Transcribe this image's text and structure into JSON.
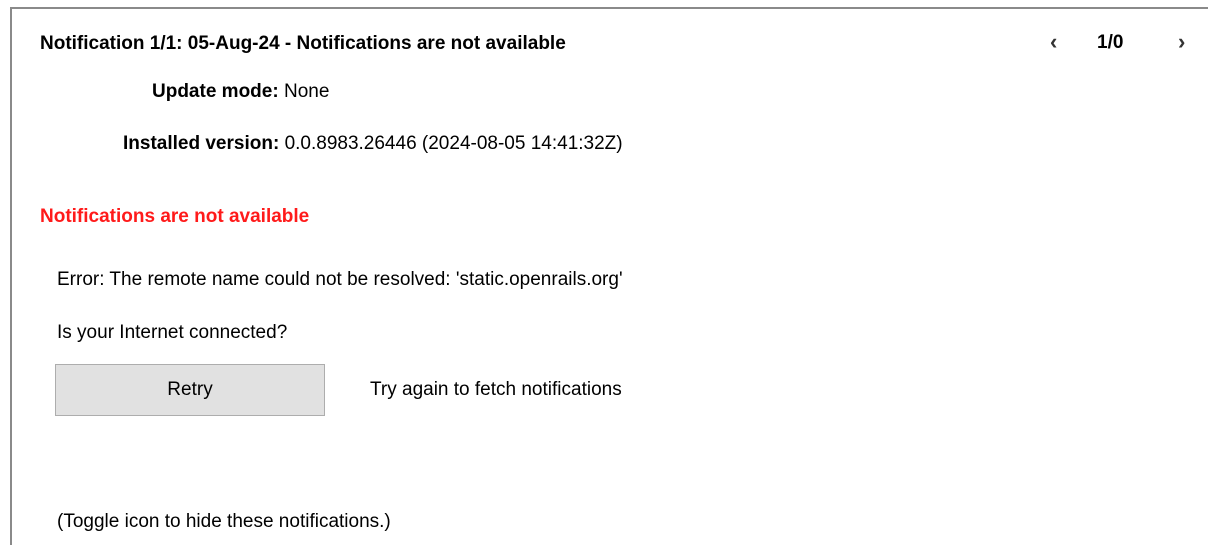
{
  "header": {
    "title": "Notification 1/1: 05-Aug-24 - Notifications are not available",
    "prev_glyph": "‹",
    "counter": "1/0",
    "next_glyph": "›"
  },
  "info": {
    "update_mode_label": "Update mode:",
    "update_mode_value": "None",
    "installed_version_label": "Installed version:",
    "installed_version_value": "0.0.8983.26446 (2024-08-05 14:41:32Z)"
  },
  "error": {
    "heading": "Notifications are not available",
    "heading_color": "#ff1a1a",
    "message": "Error: The remote name could not be resolved: 'static.openrails.org'",
    "question": "Is your Internet connected?"
  },
  "actions": {
    "retry_label": "Retry",
    "retry_description": "Try again to fetch notifications"
  },
  "footer": {
    "toggle_note": "(Toggle icon to hide these notifications.)"
  }
}
